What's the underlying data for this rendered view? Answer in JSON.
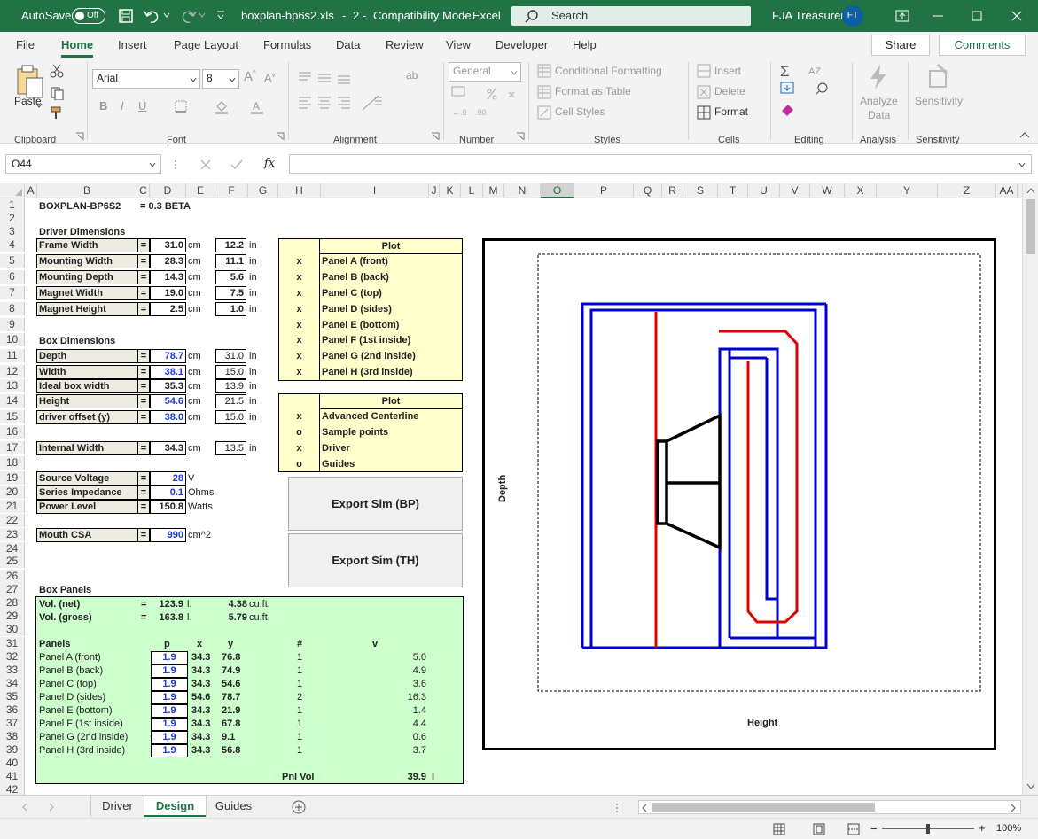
{
  "titlebar": {
    "autosave": "AutoSave",
    "toggle": "Off",
    "filename": "boxplan-bp6s2.xls",
    "sep": "-",
    "num": "2",
    "mode": "Compatibility Mode",
    "app": "Excel",
    "search": "Search",
    "user": "FJA Treasurer",
    "initials": "FT"
  },
  "menu": [
    "File",
    "Home",
    "Insert",
    "Page Layout",
    "Formulas",
    "Data",
    "Review",
    "View",
    "Developer",
    "Help"
  ],
  "menu_active": "Home",
  "share": "Share",
  "comments": "Comments",
  "ribbon": {
    "paste": "Paste",
    "clipboard": "Clipboard",
    "font_name": "Arial",
    "font_size": "8",
    "font": "Font",
    "alignment": "Alignment",
    "number_format": "General",
    "number": "Number",
    "cond": "Conditional Formatting",
    "fmt_table": "Format as Table",
    "cell_styles": "Cell Styles",
    "styles": "Styles",
    "insert": "Insert",
    "delete": "Delete",
    "format": "Format",
    "cells": "Cells",
    "editing": "Editing",
    "analyze": "Analyze",
    "analyze2": "Data",
    "analysis": "Analysis",
    "sensitivity": "Sensitivity",
    "sensitivity_grp": "Sensitivity",
    "bold": "B",
    "italic": "I",
    "underline": "U"
  },
  "namebox": "O44",
  "fx": "fx",
  "columns": [
    "A",
    "B",
    "C",
    "D",
    "E",
    "F",
    "G",
    "H",
    "I",
    "J",
    "K",
    "L",
    "M",
    "N",
    "O",
    "P",
    "Q",
    "R",
    "S",
    "T",
    "U",
    "V",
    "W",
    "X",
    "Y",
    "Z",
    "AA"
  ],
  "selected_col": "O",
  "rows": [
    "1",
    "2",
    "3",
    "4",
    "5",
    "6",
    "7",
    "8",
    "9",
    "10",
    "11",
    "12",
    "13",
    "14",
    "15",
    "16",
    "17",
    "18",
    "19",
    "20",
    "21",
    "22",
    "23",
    "24",
    "25",
    "26",
    "27",
    "28",
    "29",
    "30",
    "31",
    "32",
    "33",
    "34",
    "35",
    "36",
    "37",
    "38",
    "39",
    "40",
    "41",
    "42"
  ],
  "sheet": {
    "title": "BOXPLAN-BP6S2",
    "version": "= 0.3 BETA",
    "driver_dims": "Driver Dimensions",
    "driver": [
      {
        "label": "Frame Width",
        "v": "31.0",
        "u": "cm",
        "in": "12.2",
        "iu": "in"
      },
      {
        "label": "Mounting Width",
        "v": "28.3",
        "u": "cm",
        "in": "11.1",
        "iu": "in"
      },
      {
        "label": "Mounting Depth",
        "v": "14.3",
        "u": "cm",
        "in": "5.6",
        "iu": "in"
      },
      {
        "label": "Magnet Width",
        "v": "19.0",
        "u": "cm",
        "in": "7.5",
        "iu": "in"
      },
      {
        "label": "Magnet Height",
        "v": "2.5",
        "u": "cm",
        "in": "1.0",
        "iu": "in"
      }
    ],
    "box_dims": "Box Dimensions",
    "box": [
      {
        "label": "Depth",
        "v": "78.7",
        "u": "cm",
        "in": "31.0",
        "iu": "in",
        "blue": true
      },
      {
        "label": "Width",
        "v": "38.1",
        "u": "cm",
        "in": "15.0",
        "iu": "in",
        "blue": true
      },
      {
        "label": "Ideal box width",
        "v": "35.3",
        "u": "cm",
        "in": "13.9",
        "iu": "in",
        "blue": false
      },
      {
        "label": "Height",
        "v": "54.6",
        "u": "cm",
        "in": "21.5",
        "iu": "in",
        "blue": true
      },
      {
        "label": "driver offset (y)",
        "v": "38.0",
        "u": "cm",
        "in": "15.0",
        "iu": "in",
        "blue": true
      }
    ],
    "internal": {
      "label": "Internal Width",
      "v": "34.3",
      "u": "cm",
      "in": "13.5",
      "iu": "in"
    },
    "elec": [
      {
        "label": "Source Voltage",
        "v": "28",
        "u": "V"
      },
      {
        "label": "Series Impedance",
        "v": "0.1",
        "u": "Ohms"
      },
      {
        "label": "Power Level",
        "v": "150.8",
        "u": "Watts"
      }
    ],
    "mouth": {
      "label": "Mouth CSA",
      "v": "990",
      "u": "cm^2"
    },
    "eq": "=",
    "plot1": {
      "header": "Plot",
      "items": [
        {
          "mark": "x",
          "label": "Panel A (front)"
        },
        {
          "mark": "x",
          "label": "Panel B (back)"
        },
        {
          "mark": "x",
          "label": "Panel C (top)"
        },
        {
          "mark": "x",
          "label": "Panel D (sides)"
        },
        {
          "mark": "x",
          "label": "Panel E (bottom)"
        },
        {
          "mark": "x",
          "label": "Panel F (1st inside)"
        },
        {
          "mark": "x",
          "label": "Panel G (2nd inside)"
        },
        {
          "mark": "x",
          "label": "Panel H (3rd inside)"
        }
      ]
    },
    "plot2": {
      "header": "Plot",
      "items": [
        {
          "mark": "x",
          "label": "Advanced Centerline"
        },
        {
          "mark": "o",
          "label": "Sample points"
        },
        {
          "mark": "x",
          "label": "Driver"
        },
        {
          "mark": "o",
          "label": "Guides"
        }
      ]
    },
    "export_bp": "Export Sim (BP)",
    "export_th": "Export Sim (TH)",
    "box_panels": "Box Panels",
    "vol_net": {
      "label": "Vol. (net)",
      "eq": "=",
      "v": "123.9",
      "u": "l.",
      "cf": "4.38",
      "cfu": "cu.ft."
    },
    "vol_gross": {
      "label": "Vol. (gross)",
      "eq": "=",
      "v": "163.8",
      "u": "l.",
      "cf": "5.79",
      "cfu": "cu.ft."
    },
    "panel_hdr": {
      "panels": "Panels",
      "p": "p",
      "x": "x",
      "y": "y",
      "n": "#",
      "v": "v"
    },
    "panels": [
      {
        "name": "Panel A (front)",
        "p": "1.9",
        "x": "34.3",
        "y": "76.8",
        "n": "1",
        "v": "5.0"
      },
      {
        "name": "Panel B (back)",
        "p": "1.9",
        "x": "34.3",
        "y": "74.9",
        "n": "1",
        "v": "4.9"
      },
      {
        "name": "Panel C (top)",
        "p": "1.9",
        "x": "34.3",
        "y": "54.6",
        "n": "1",
        "v": "3.6"
      },
      {
        "name": "Panel D (sides)",
        "p": "1.9",
        "x": "54.6",
        "y": "78.7",
        "n": "2",
        "v": "16.3"
      },
      {
        "name": "Panel E (bottom)",
        "p": "1.9",
        "x": "34.3",
        "y": "21.9",
        "n": "1",
        "v": "1.4"
      },
      {
        "name": "Panel F (1st inside)",
        "p": "1.9",
        "x": "34.3",
        "y": "67.8",
        "n": "1",
        "v": "4.4"
      },
      {
        "name": "Panel G (2nd inside)",
        "p": "1.9",
        "x": "34.3",
        "y": "9.1",
        "n": "1",
        "v": "0.6"
      },
      {
        "name": "Panel H (3rd inside)",
        "p": "1.9",
        "x": "34.3",
        "y": "56.8",
        "n": "1",
        "v": "3.7"
      }
    ],
    "pnl_vol": {
      "label": "Pnl Vol",
      "v": "39.9",
      "u": "l"
    }
  },
  "chart": {
    "xlabel": "Height",
    "ylabel": "Depth"
  },
  "tabs": [
    "Driver",
    "Design",
    "Guides"
  ],
  "active_tab": "Design",
  "zoom": "100%",
  "colors": {
    "excel_green": "#217346",
    "plot_yellow": "#ffffcc",
    "panel_green": "#ccffcc",
    "blue_line": "#0000cc",
    "red_line": "#dd0000"
  }
}
